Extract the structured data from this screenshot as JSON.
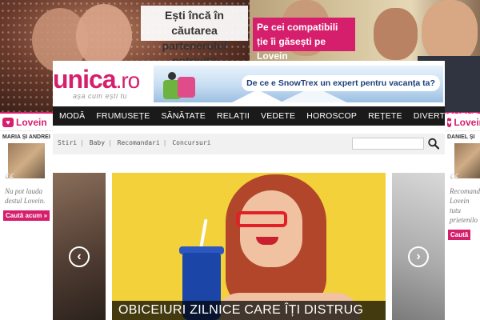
{
  "top_ad": {
    "headline_dark": "Ești încă în căutarea partenerului potrivit?",
    "headline_pink": "Pe cei compatibili ție îi găsești pe Lovein"
  },
  "side_ads": {
    "brand": "Lovein",
    "left": {
      "couple": "MARIA ȘI ANDREI",
      "quote": "Nu pot lauda destul Lovein.",
      "cta": "Caută acum »"
    },
    "right": {
      "couple": "DANIEL ȘI",
      "quote": "Recomand Lovein tutu prietenilo",
      "cta": "Caută"
    }
  },
  "header": {
    "logo_main": "unica",
    "logo_suffix": ".ro",
    "tagline": "așa cum ești tu",
    "banner_text": "De ce e SnowTrex un expert pentru vacanța ta?"
  },
  "nav": {
    "items": [
      "MODĂ",
      "FRUMUSEȚE",
      "SĂNĂTATE",
      "RELAȚII",
      "VEDETE",
      "HOROSCOP",
      "REȚETE",
      "DIVERTISMENT"
    ]
  },
  "subnav": {
    "links": [
      "Stiri",
      "Baby",
      "Recomandari",
      "Concursuri"
    ],
    "search_value": ""
  },
  "slider": {
    "caption": "OBICEIURI ZILNICE CARE ÎȚI DISTRUG",
    "prev_icon": "‹",
    "next_icon": "›"
  },
  "colors": {
    "brand_pink": "#d61f6c",
    "nav_bg": "#1a1a1a",
    "slide_bg": "#f2d13a"
  }
}
